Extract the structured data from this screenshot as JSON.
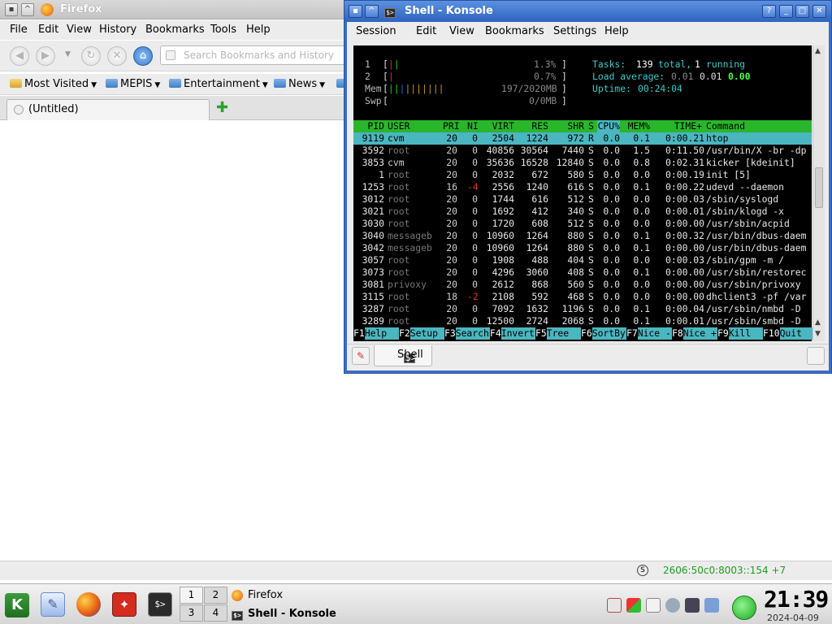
{
  "firefox": {
    "title": "Firefox",
    "menu": [
      "File",
      "Edit",
      "View",
      "History",
      "Bookmarks",
      "Tools",
      "Help"
    ],
    "search_placeholder": "Search Bookmarks and History",
    "bookmarks": [
      "Most Visited",
      "MEPIS",
      "Entertainment",
      "News"
    ],
    "tab_title": "(Untitled)",
    "status_ip": "2606:50c0:8003::154 +7"
  },
  "konsole": {
    "title": "Shell - Konsole",
    "menu": [
      "Session",
      "Edit",
      "View",
      "Bookmarks",
      "Settings",
      "Help"
    ],
    "tab_label": "Shell",
    "htop": {
      "cpu1_label": "1",
      "cpu1_pct": "1.3%",
      "cpu2_label": "2",
      "cpu2_pct": "0.7%",
      "mem_label": "Mem",
      "mem_val": "197/2020MB",
      "swp_label": "Swp",
      "swp_val": "0/0MB",
      "tasks_label": "Tasks:",
      "tasks_total": "139",
      "tasks_total_word": "total,",
      "tasks_running": "1",
      "tasks_running_word": "running",
      "load_label": "Load average:",
      "load1": "0.01",
      "load5": "0.01",
      "load15": "0.00",
      "uptime_label": "Uptime:",
      "uptime": "00:24:04",
      "columns": [
        "PID",
        "USER",
        "PRI",
        "NI",
        "VIRT",
        "RES",
        "SHR",
        "S",
        "CPU%",
        "MEM%",
        "TIME+",
        "Command"
      ],
      "rows": [
        [
          "9119",
          "cvm",
          "20",
          "0",
          "2504",
          "1224",
          "972",
          "R",
          "0.0",
          "0.1",
          "0:00.21",
          "htop"
        ],
        [
          "3592",
          "root",
          "20",
          "0",
          "40856",
          "30564",
          "7440",
          "S",
          "0.0",
          "1.5",
          "0:11.50",
          "/usr/bin/X -br -dp"
        ],
        [
          "3853",
          "cvm",
          "20",
          "0",
          "35636",
          "16528",
          "12840",
          "S",
          "0.0",
          "0.8",
          "0:02.31",
          "kicker [kdeinit]"
        ],
        [
          "1",
          "root",
          "20",
          "0",
          "2032",
          "672",
          "580",
          "S",
          "0.0",
          "0.0",
          "0:00.19",
          "init [5]"
        ],
        [
          "1253",
          "root",
          "16",
          "-4",
          "2556",
          "1240",
          "616",
          "S",
          "0.0",
          "0.1",
          "0:00.22",
          "udevd --daemon"
        ],
        [
          "3012",
          "root",
          "20",
          "0",
          "1744",
          "616",
          "512",
          "S",
          "0.0",
          "0.0",
          "0:00.03",
          "/sbin/syslogd"
        ],
        [
          "3021",
          "root",
          "20",
          "0",
          "1692",
          "412",
          "340",
          "S",
          "0.0",
          "0.0",
          "0:00.01",
          "/sbin/klogd -x"
        ],
        [
          "3030",
          "root",
          "20",
          "0",
          "1720",
          "608",
          "512",
          "S",
          "0.0",
          "0.0",
          "0:00.00",
          "/usr/sbin/acpid"
        ],
        [
          "3040",
          "messageb",
          "20",
          "0",
          "10960",
          "1264",
          "880",
          "S",
          "0.0",
          "0.1",
          "0:00.32",
          "/usr/bin/dbus-daem"
        ],
        [
          "3042",
          "messageb",
          "20",
          "0",
          "10960",
          "1264",
          "880",
          "S",
          "0.0",
          "0.1",
          "0:00.00",
          "/usr/bin/dbus-daem"
        ],
        [
          "3057",
          "root",
          "20",
          "0",
          "1908",
          "488",
          "404",
          "S",
          "0.0",
          "0.0",
          "0:00.03",
          "/sbin/gpm -m /"
        ],
        [
          "3073",
          "root",
          "20",
          "0",
          "4296",
          "3060",
          "408",
          "S",
          "0.0",
          "0.1",
          "0:00.00",
          "/usr/sbin/restorec"
        ],
        [
          "3081",
          "privoxy",
          "20",
          "0",
          "2612",
          "868",
          "560",
          "S",
          "0.0",
          "0.0",
          "0:00.00",
          "/usr/sbin/privoxy"
        ],
        [
          "3115",
          "root",
          "18",
          "-2",
          "2108",
          "592",
          "468",
          "S",
          "0.0",
          "0.0",
          "0:00.00",
          "dhclient3 -pf /var"
        ],
        [
          "3287",
          "root",
          "20",
          "0",
          "7092",
          "1632",
          "1196",
          "S",
          "0.0",
          "0.1",
          "0:00.04",
          "/usr/sbin/nmbd -D"
        ],
        [
          "3289",
          "root",
          "20",
          "0",
          "12500",
          "2724",
          "2068",
          "S",
          "0.0",
          "0.1",
          "0:00.01",
          "/usr/sbin/smbd -D"
        ]
      ],
      "fkeys": [
        {
          "key": "F1",
          "label": "Help"
        },
        {
          "key": "F2",
          "label": "Setup"
        },
        {
          "key": "F3",
          "label": "Search"
        },
        {
          "key": "F4",
          "label": "Invert"
        },
        {
          "key": "F5",
          "label": "Tree"
        },
        {
          "key": "F6",
          "label": "SortBy"
        },
        {
          "key": "F7",
          "label": "Nice -"
        },
        {
          "key": "F8",
          "label": "Nice +"
        },
        {
          "key": "F9",
          "label": "Kill"
        },
        {
          "key": "F10",
          "label": "Quit"
        }
      ]
    }
  },
  "taskbar": {
    "pager": [
      "1",
      "2",
      "3",
      "4"
    ],
    "tasks": [
      "Firefox",
      "Shell - Konsole"
    ],
    "clock": "21:39",
    "date": "2024-04-09"
  },
  "colors": {
    "konsole_titlebar": "#3b6fc6",
    "htop_header_bg": "#29b62b",
    "htop_selected_bg": "#4ab6c0",
    "status_ip_color": "#1e9e1e"
  }
}
